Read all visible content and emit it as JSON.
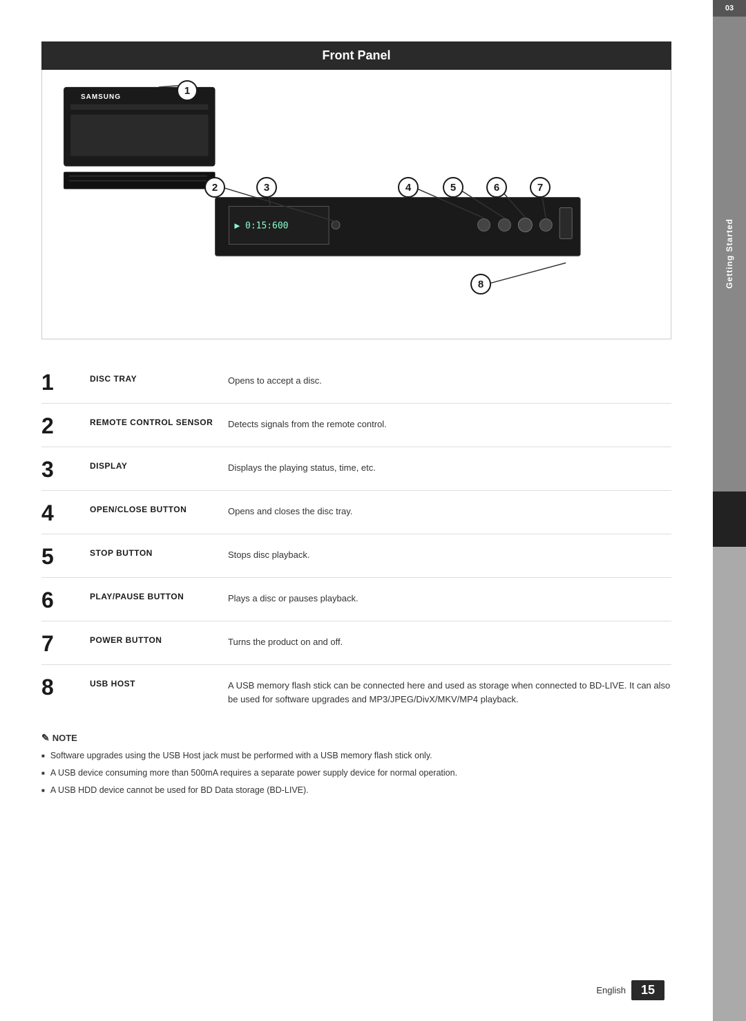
{
  "page": {
    "title": "Front Panel",
    "section_number": "03",
    "section_label": "Getting Started",
    "page_language": "English",
    "page_number": "15"
  },
  "diagram": {
    "brand": "SAMSUNG",
    "display_text": "▶ 0:15:600",
    "callouts": [
      "1",
      "2",
      "3",
      "4",
      "5",
      "6",
      "7",
      "8"
    ]
  },
  "components": [
    {
      "number": "1",
      "name": "DISC TRAY",
      "description": "Opens to accept a disc."
    },
    {
      "number": "2",
      "name": "REMOTE CONTROL SENSOR",
      "description": "Detects signals from the remote control."
    },
    {
      "number": "3",
      "name": "DISPLAY",
      "description": "Displays the playing status, time, etc."
    },
    {
      "number": "4",
      "name": "OPEN/CLOSE BUTTON",
      "description": "Opens and closes the disc tray."
    },
    {
      "number": "5",
      "name": "STOP BUTTON",
      "description": "Stops disc playback."
    },
    {
      "number": "6",
      "name": "PLAY/PAUSE BUTTON",
      "description": "Plays a disc or pauses playback."
    },
    {
      "number": "7",
      "name": "POWER BUTTON",
      "description": "Turns the product on and off."
    },
    {
      "number": "8",
      "name": "USB HOST",
      "description": "A USB memory flash stick can be connected here and used as storage when connected to BD-LIVE. It can also be used for software upgrades and MP3/JPEG/DivX/MKV/MP4 playback."
    }
  ],
  "notes": {
    "title": "NOTE",
    "items": [
      "Software upgrades using the USB Host jack must be performed with a USB memory flash stick only.",
      "A USB device consuming more than 500mA requires a separate power supply device for normal operation.",
      "A USB HDD device cannot be used for BD Data storage (BD-LIVE)."
    ]
  }
}
